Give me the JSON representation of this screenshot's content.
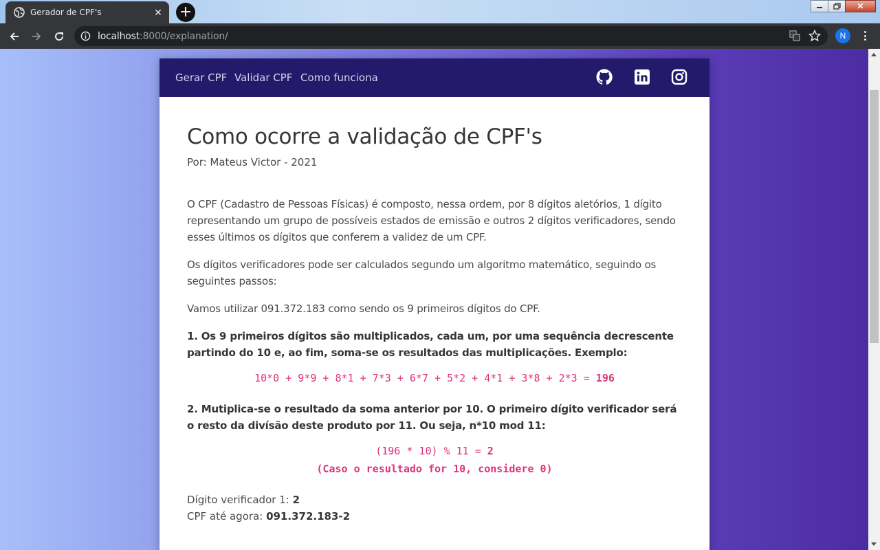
{
  "browser": {
    "tab_title": "Gerador de CPF's",
    "url_host": "localhost",
    "url_path": ":8000/explanation/",
    "avatar_letter": "N"
  },
  "site_nav": {
    "links": [
      "Gerar CPF",
      "Validar CPF",
      "Como funciona"
    ],
    "icons": [
      "github-icon",
      "linkedin-icon",
      "instagram-icon"
    ]
  },
  "article": {
    "title": "Como ocorre a validação de CPF's",
    "byline": "Por: Mateus Victor - 2021",
    "p1": "O CPF (Cadastro de Pessoas Físicas) é composto, nessa ordem, por 8 dígitos aletórios, 1 dígito representando um grupo de possíveis estados de emissão e outros 2 dígitos verificadores, sendo esses últimos os dígitos que conferem a validez de um CPF.",
    "p2": "Os dígitos verificadores pode ser calculados segundo um algoritmo matemático, seguindo os seguintes passos:",
    "p3": "Vamos utilizar 091.372.183 como sendo os 9 primeiros dígitos do CPF.",
    "step1": "1. Os 9 primeiros dígitos são multiplicados, cada um, por uma sequência decrescente partindo do 10 e, ao fim, soma-se os resultados das multiplicações. Exemplo:",
    "formula1": "10*0 + 9*9 + 8*1 + 7*3 + 6*7 + 5*2 + 4*1 + 3*8 + 2*3 = ",
    "formula1_result": "196",
    "step2": "2. Mutiplica-se o resultado da soma anterior por 10. O primeiro dígito verificador será o resto da divísão deste produto por 11. Ou seja, n*10 mod 11:",
    "formula2": "(196 * 10) % 11 = ",
    "formula2_result": "2",
    "formula2_note": "(Caso o resultado for 10, considere 0)",
    "digit1_label": "Dígito verificador 1: ",
    "digit1_value": "2",
    "cpf_label": "CPF até agora: ",
    "cpf_value": "091.372.183-2"
  },
  "colors": {
    "nav_bg": "#241a6b",
    "formula": "#e0317a"
  }
}
